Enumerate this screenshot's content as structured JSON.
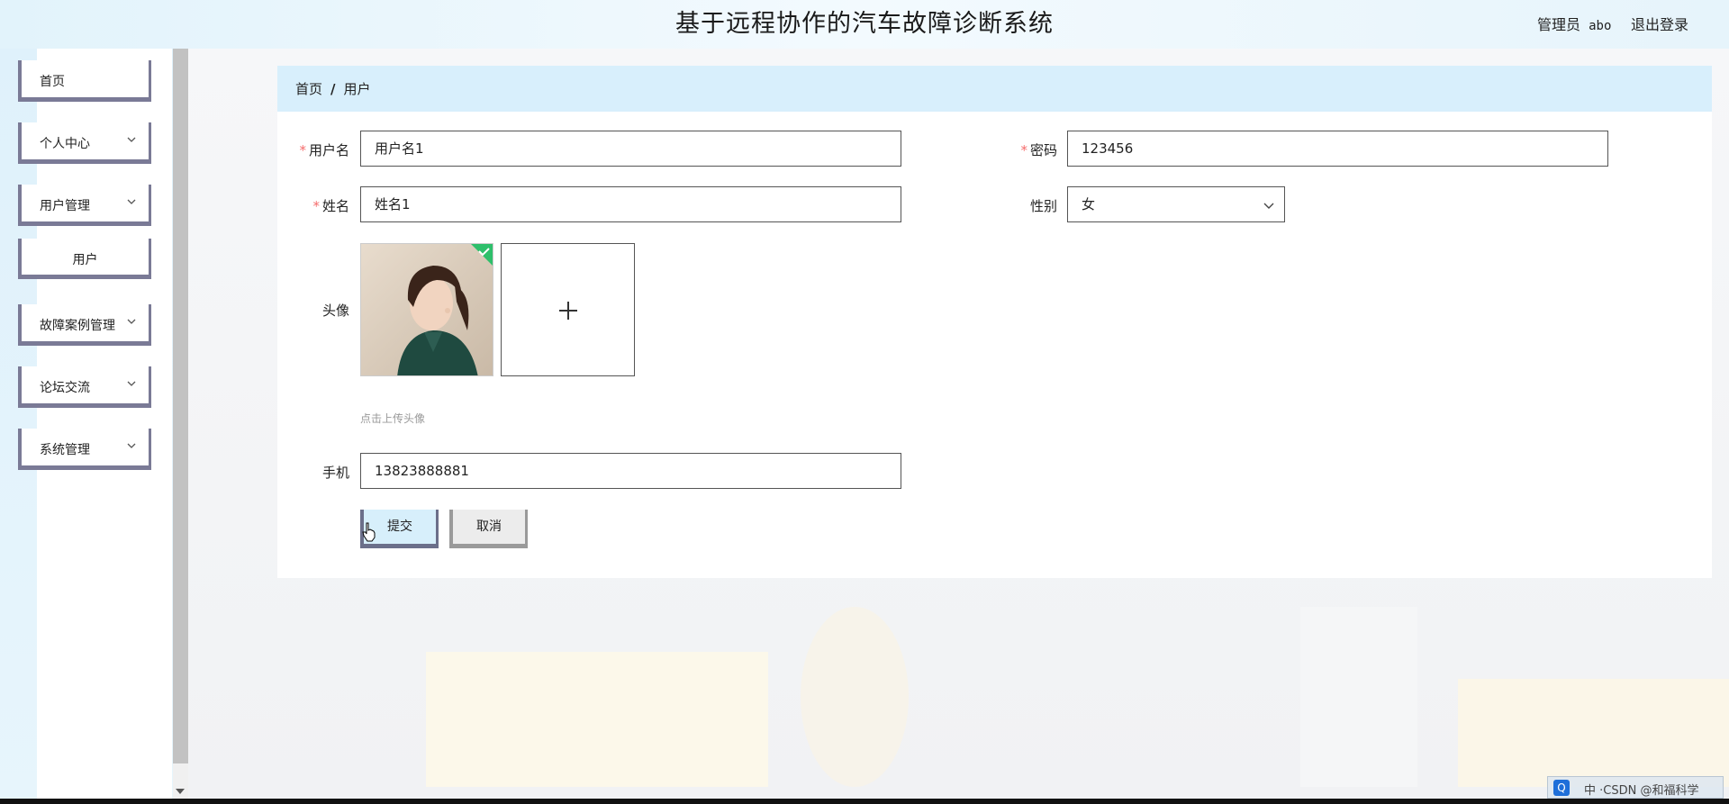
{
  "header": {
    "title": "基于远程协作的汽车故障诊断系统",
    "admin_role": "管理员",
    "admin_name": "abo",
    "logout_label": "退出登录"
  },
  "sidebar": {
    "items": [
      {
        "label": "首页",
        "icon": null
      },
      {
        "label": "个人中心",
        "icon": "chevron-down-icon"
      },
      {
        "label": "用户管理",
        "icon": "chevron-down-icon"
      },
      {
        "label": "用户",
        "icon": null
      },
      {
        "label": "故障案例管理",
        "icon": "chevron-down-icon"
      },
      {
        "label": "论坛交流",
        "icon": "chevron-down-icon"
      },
      {
        "label": "系统管理",
        "icon": "chevron-down-icon"
      }
    ]
  },
  "breadcrumb": {
    "home": "首页",
    "separator": "/",
    "current": "用户"
  },
  "form": {
    "username": {
      "label": "用户名",
      "value": "用户名1",
      "required": true
    },
    "password": {
      "label": "密码",
      "value": "123456",
      "required": true
    },
    "name": {
      "label": "姓名",
      "value": "姓名1",
      "required": true
    },
    "gender": {
      "label": "性别",
      "value": "女"
    },
    "avatar": {
      "label": "头像",
      "hint": "点击上传头像",
      "upload_icon": "plus-icon"
    },
    "phone": {
      "label": "手机",
      "value": "13823888881"
    },
    "submit_label": "提交",
    "cancel_label": "取消"
  },
  "ime": {
    "icon_letter": "Q",
    "text": "中 ·CSDN @和福科学"
  },
  "colors": {
    "breadcrumb_bg": "#d8effc",
    "required_star": "#f56c6c",
    "menu_border": "#7a7a96",
    "success_badge": "#2ebf6b"
  }
}
